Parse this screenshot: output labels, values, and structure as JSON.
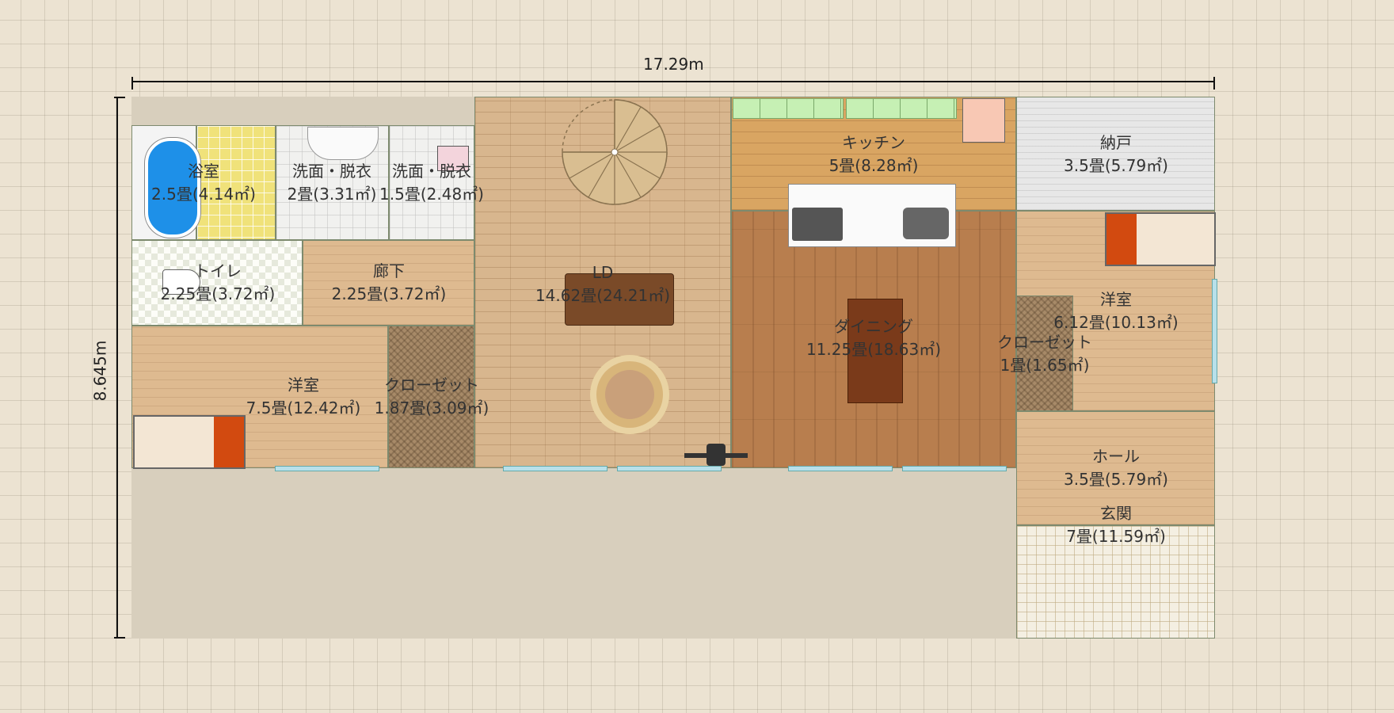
{
  "dimensions": {
    "width": "17.29m",
    "height": "8.645m"
  },
  "rooms": {
    "bath": {
      "name": "浴室",
      "area": "2.5畳(4.14㎡)"
    },
    "wash1": {
      "name": "洗面・脱衣",
      "area": "2畳(3.31㎡)"
    },
    "wash2": {
      "name": "洗面・脱衣",
      "area": "1.5畳(2.48㎡)"
    },
    "toilet": {
      "name": "トイレ",
      "area": "2.25畳(3.72㎡)"
    },
    "corridor": {
      "name": "廊下",
      "area": "2.25畳(3.72㎡)"
    },
    "western1": {
      "name": "洋室",
      "area": "7.5畳(12.42㎡)"
    },
    "closet1": {
      "name": "クローゼット",
      "area": "1.87畳(3.09㎡)"
    },
    "ld": {
      "name": "LD",
      "area": "14.62畳(24.21㎡)"
    },
    "kitchen": {
      "name": "キッチン",
      "area": "5畳(8.28㎡)"
    },
    "dining": {
      "name": "ダイニング",
      "area": "11.25畳(18.63㎡)"
    },
    "storage": {
      "name": "納戸",
      "area": "3.5畳(5.79㎡)"
    },
    "western2": {
      "name": "洋室",
      "area": "6.12畳(10.13㎡)"
    },
    "closet2": {
      "name": "クローゼット",
      "area": "1畳(1.65㎡)"
    },
    "hall": {
      "name": "ホール",
      "area": "3.5畳(5.79㎡)"
    },
    "entrance": {
      "name": "玄関",
      "area": "7畳(11.59㎡)"
    }
  },
  "colors": {
    "bathtub": "#1e90e8",
    "bed_accent": "#d24a10",
    "cabinet": "#c6f0b4"
  }
}
